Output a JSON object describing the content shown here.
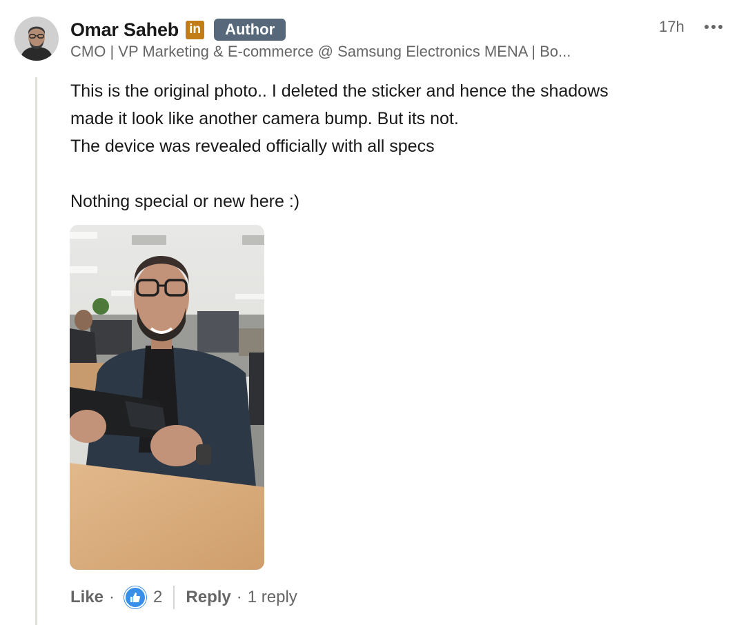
{
  "comment": {
    "author": {
      "name": "Omar Saheb",
      "linkedin_badge": "in",
      "role_badge": "Author",
      "headline": "CMO | VP Marketing & E-commerce @ Samsung Electronics MENA | Bo...",
      "timestamp": "17h"
    },
    "body": {
      "lines": [
        "This is the original photo.. I deleted the sticker and hence the shadows",
        "made it look like another camera bump. But its not.",
        "The device was revealed officially with all specs",
        "",
        "Nothing special or new here :)"
      ]
    },
    "actions": {
      "like_label": "Like",
      "reaction_count": "2",
      "reply_label": "Reply",
      "reply_count": "1 reply"
    }
  },
  "colors": {
    "text_primary": "#191919",
    "text_secondary": "#666666",
    "author_badge": "#56687a",
    "linkedin_badge": "#c37d16",
    "like_reaction": "#378fe9",
    "thread_line": "#e0dfdc"
  },
  "icons": {
    "more_menu": "ellipsis-icon",
    "reaction": "thumbs-up-icon"
  }
}
